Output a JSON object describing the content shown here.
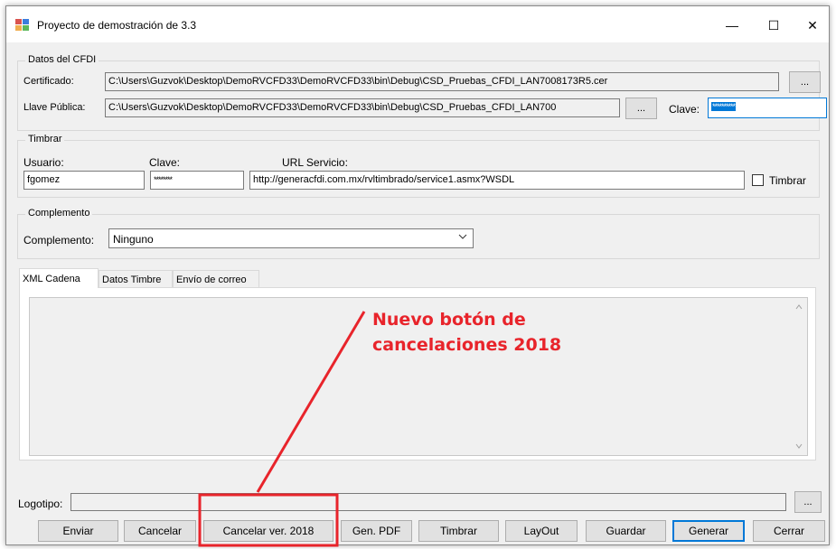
{
  "window": {
    "title": "Proyecto de demostración de 3.3",
    "minimize_glyph": "—",
    "maximize_glyph": "☐",
    "close_glyph": "✕"
  },
  "datos_cfdi": {
    "group_title": "Datos del CFDI",
    "certificado_label": "Certificado:",
    "certificado_value": "C:\\Users\\Guzvok\\Desktop\\DemoRVCFD33\\DemoRVCFD33\\bin\\Debug\\CSD_Pruebas_CFDI_LAN7008173R5.cer",
    "browse_label": "...",
    "llave_label": "Llave Pública:",
    "llave_value": "C:\\Users\\Guzvok\\Desktop\\DemoRVCFD33\\DemoRVCFD33\\bin\\Debug\\CSD_Pruebas_CFDI_LAN700",
    "clave_label": "Clave:",
    "clave_value": "**********"
  },
  "timbrar": {
    "group_title": "Timbrar",
    "usuario_label": "Usuario:",
    "usuario_value": "fgomez",
    "clave_label": "Clave:",
    "clave_value": "********",
    "url_label": "URL Servicio:",
    "url_value": "http://generacfdi.com.mx/rvltimbrado/service1.asmx?WSDL",
    "timbrar_checkbox_label": "Timbrar",
    "timbrar_checked": false
  },
  "complemento": {
    "group_title": "Complemento",
    "label": "Complemento:",
    "selected": "Ninguno"
  },
  "tabs": [
    {
      "label": "XML Cadena",
      "active": true
    },
    {
      "label": "Datos Timbre",
      "active": false
    },
    {
      "label": "Envío de correo",
      "active": false
    }
  ],
  "logotipo": {
    "label": "Logotipo:",
    "value": "",
    "browse_label": "..."
  },
  "buttons": {
    "enviar": "Enviar",
    "cancelar": "Cancelar",
    "cancelar_2018": "Cancelar ver. 2018",
    "gen_pdf": "Gen. PDF",
    "timbrar": "Timbrar",
    "layout": "LayOut",
    "guardar": "Guardar",
    "generar": "Generar",
    "cerrar": "Cerrar"
  },
  "annotation": {
    "line1": "Nuevo botón de",
    "line2": "cancelaciones 2018",
    "color": "#e8242b"
  },
  "colors": {
    "window_bg": "#f0f0f0",
    "accent": "#0078d7"
  }
}
